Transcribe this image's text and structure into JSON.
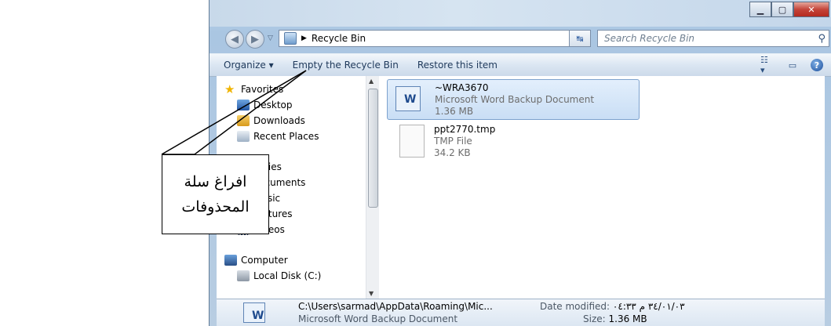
{
  "window": {
    "caption_buttons": [
      "minimize",
      "maximize",
      "close"
    ]
  },
  "address_bar": {
    "location": "Recycle Bin",
    "search_placeholder": "Search Recycle Bin"
  },
  "toolbar": {
    "organize": "Organize ▾",
    "empty_bin": "Empty the Recycle Bin",
    "restore": "Restore this item"
  },
  "navigation": {
    "favorites": "Favorites",
    "desktop": "Desktop",
    "downloads": "Downloads",
    "recent_places": "Recent Places",
    "libraries": "Libraries",
    "documents": "Documents",
    "music": "Music",
    "pictures": "Pictures",
    "videos": "Videos",
    "computer": "Computer",
    "local_disk": "Local Disk (C:)"
  },
  "files": [
    {
      "name": "~WRA3670",
      "type": "Microsoft Word Backup Document",
      "size": "1.36 MB",
      "selected": true
    },
    {
      "name": "ppt2770.tmp",
      "type": "TMP File",
      "size": "34.2 KB",
      "selected": false
    }
  ],
  "details_pane": {
    "path": "C:\\Users\\sarmad\\AppData\\Roaming\\Mic...",
    "type": "Microsoft Word Backup Document",
    "date_label": "Date modified:",
    "date_value": "٣٤/٠١/٠٣ م ٠٤:٣٣",
    "size_label": "Size:",
    "size_value": "1.36 MB"
  },
  "callout": {
    "line1": "افراغ سلة",
    "line2": "المحذوفات"
  },
  "colors": {
    "toolbar_text": "#1e395b",
    "selection_border": "#7da2ce",
    "close_button": "#c4453a"
  }
}
